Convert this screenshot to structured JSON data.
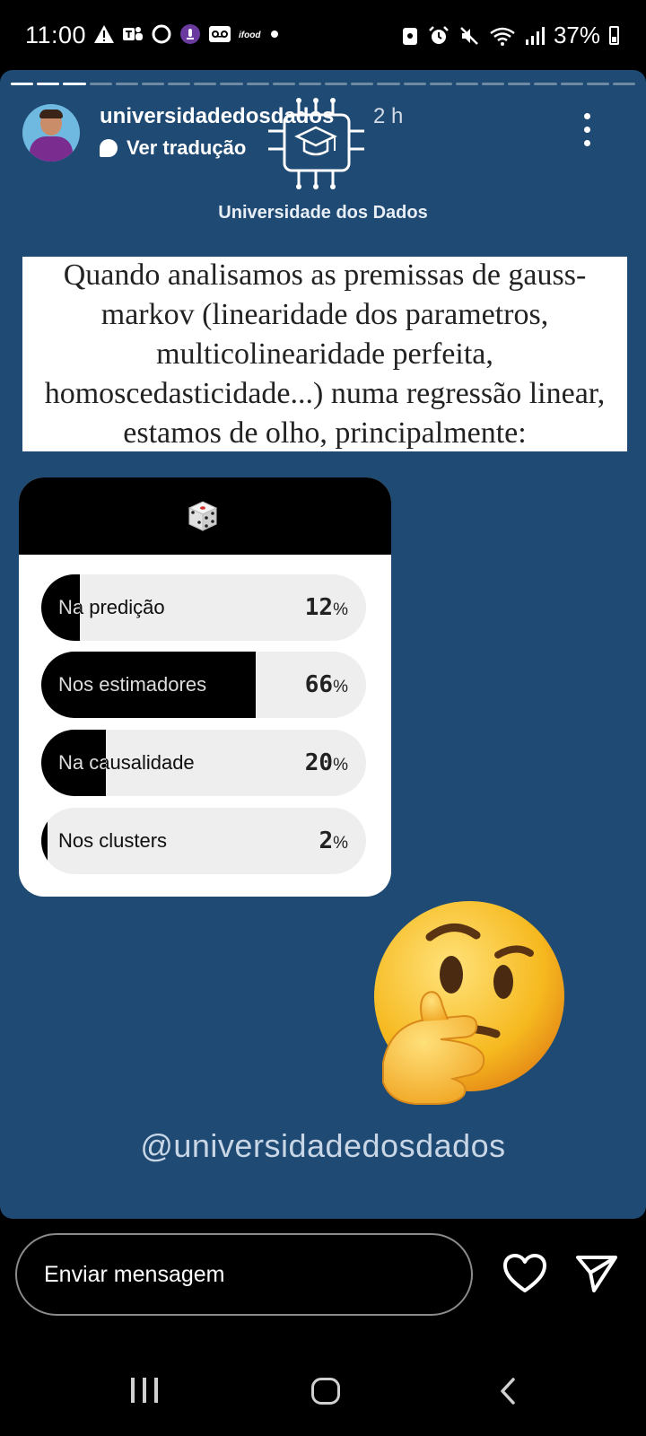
{
  "status_bar": {
    "time": "11:00",
    "battery": "37%"
  },
  "story": {
    "username": "universidadedosdados",
    "age": "2 h",
    "translate_label": "Ver tradução",
    "brand_text": "Universidade dos Dados",
    "question": "Quando analisamos as premissas de gauss-markov (linearidade dos parametros, multicolinearidade perfeita, homoscedasticidade...) numa regressão linear, estamos de olho, principalmente:",
    "poll": {
      "icon": "dice-icon",
      "options": [
        {
          "label": "Na predição",
          "percent": 12,
          "percent_text": "12"
        },
        {
          "label": "Nos estimadores",
          "percent": 66,
          "percent_text": "66"
        },
        {
          "label": "Na causalidade",
          "percent": 20,
          "percent_text": "20"
        },
        {
          "label": "Nos clusters",
          "percent": 2,
          "percent_text": "2"
        }
      ],
      "percent_sign": "%"
    },
    "handle": "@universidadedosdados",
    "progress": {
      "total": 24,
      "done": 3
    }
  },
  "bottom_bar": {
    "message_placeholder": "Enviar mensagem"
  },
  "colors": {
    "story_bg": "#1f4a73",
    "poll_fill": "#000000",
    "poll_track": "#eeeeee"
  }
}
